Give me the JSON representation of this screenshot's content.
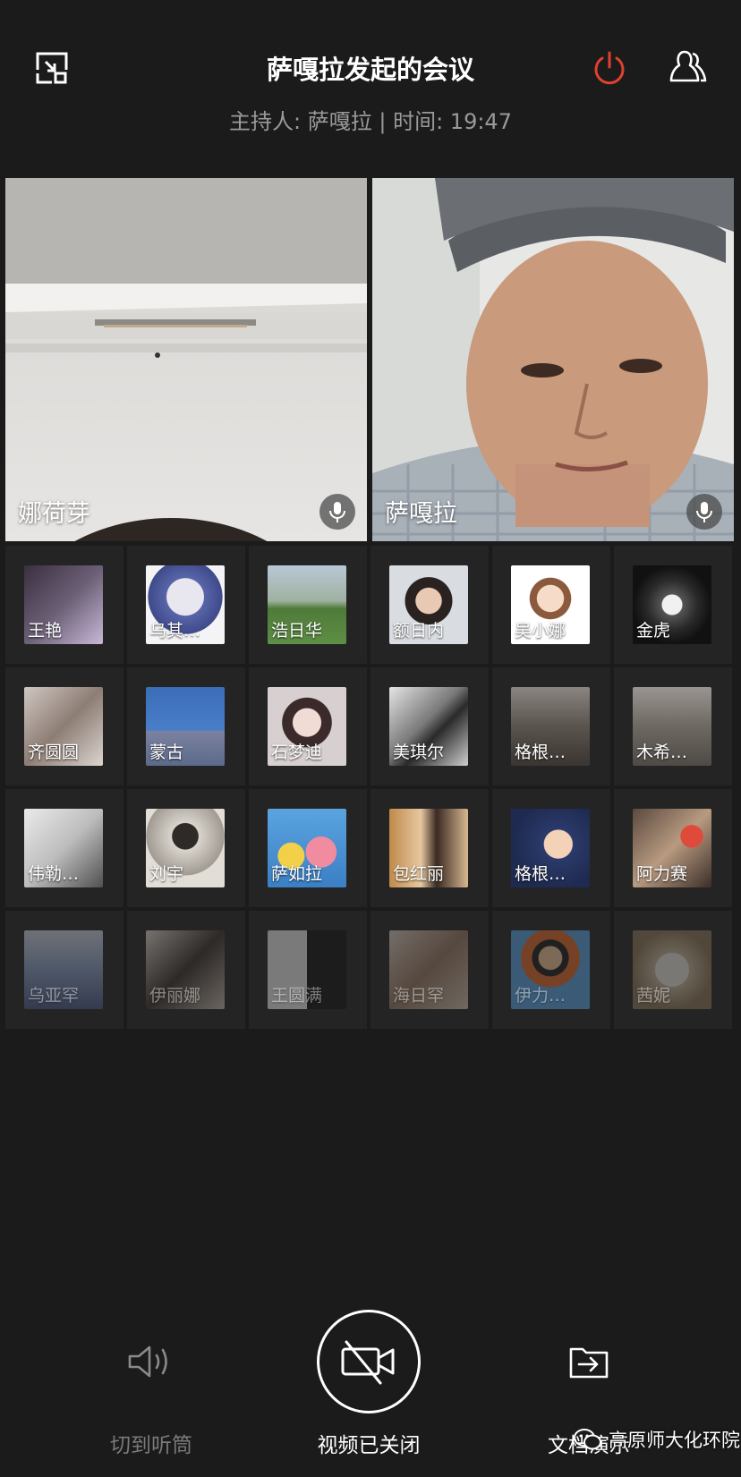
{
  "header": {
    "title": "萨嘎拉发起的会议",
    "subtitle": "主持人: 萨嘎拉 | 时间: 19:47",
    "end_icon_color": "#e0402e"
  },
  "main_videos": [
    {
      "name": "娜荷芽"
    },
    {
      "name": "萨嘎拉"
    }
  ],
  "participants": [
    {
      "name": "王艳"
    },
    {
      "name": "乌其…"
    },
    {
      "name": "浩日华"
    },
    {
      "name": "额日内"
    },
    {
      "name": "吴小娜"
    },
    {
      "name": "金虎"
    },
    {
      "name": "齐圆圆"
    },
    {
      "name": "蒙古"
    },
    {
      "name": "石梦迪"
    },
    {
      "name": "美琪尔"
    },
    {
      "name": "格根…"
    },
    {
      "name": "木希…"
    },
    {
      "name": "伟勒…"
    },
    {
      "name": "刘宇"
    },
    {
      "name": "萨如拉"
    },
    {
      "name": "包红丽"
    },
    {
      "name": "格根…"
    },
    {
      "name": "阿力赛"
    },
    {
      "name": "乌亚罕"
    },
    {
      "name": "伊丽娜"
    },
    {
      "name": "王圆满"
    },
    {
      "name": "海日罕"
    },
    {
      "name": "伊力…"
    },
    {
      "name": "茜妮"
    }
  ],
  "controls": {
    "speaker_label": "切到听筒",
    "video_label": "视频已关闭",
    "document_label": "文档演示"
  },
  "watermark": "高原师大化环院"
}
